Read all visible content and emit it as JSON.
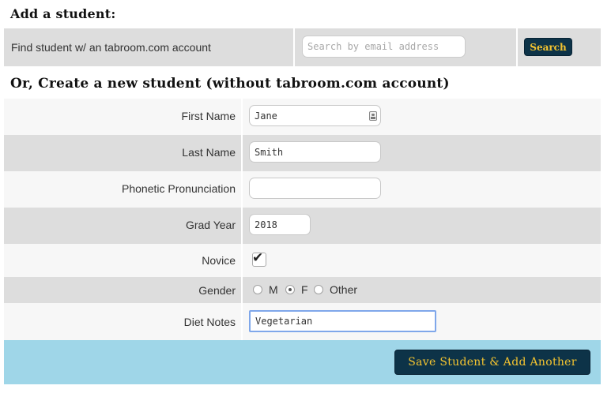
{
  "headings": {
    "add_student": "Add a student:",
    "create_new": "Or, Create a new student (without tabroom.com account)"
  },
  "search": {
    "label": "Find student w/ an tabroom.com account",
    "placeholder": "Search by email address",
    "button_label": "Search"
  },
  "form": {
    "first_name": {
      "label": "First Name",
      "value": "Jane"
    },
    "last_name": {
      "label": "Last Name",
      "value": "Smith"
    },
    "phonetic": {
      "label": "Phonetic Pronunciation",
      "value": ""
    },
    "grad_year": {
      "label": "Grad Year",
      "value": "2018"
    },
    "novice": {
      "label": "Novice",
      "checked": true
    },
    "gender": {
      "label": "Gender",
      "options": [
        "M",
        "F",
        "Other"
      ],
      "selected": "F"
    },
    "diet_notes": {
      "label": "Diet Notes",
      "value": "Vegetarian"
    }
  },
  "footer": {
    "save_label": "Save Student & Add Another"
  },
  "colors": {
    "button_bg": "#0d3348",
    "button_text": "#f4c430",
    "footer_bg": "#9fd6e8",
    "row_dark": "#dddddd",
    "row_light": "#f7f7f7"
  },
  "icons": {
    "first_name_field": "contact-card-icon",
    "novice_check": "checkmark-icon"
  }
}
